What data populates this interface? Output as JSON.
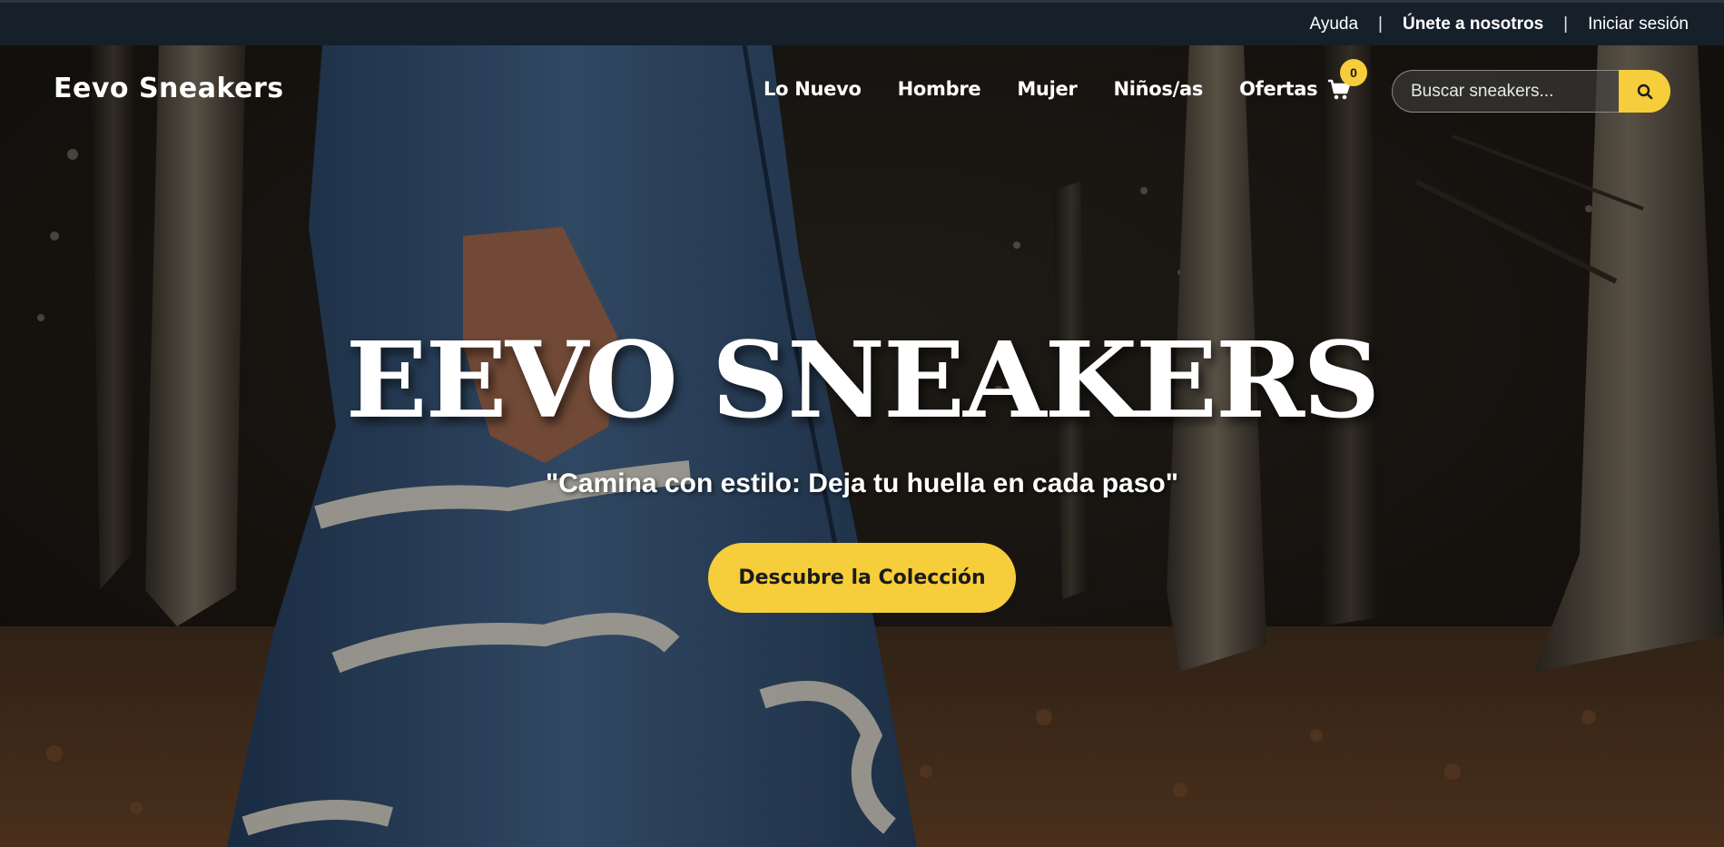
{
  "topbar": {
    "help": "Ayuda",
    "separator": "|",
    "join": "Únete a nosotros",
    "login": "Iniciar sesión"
  },
  "nav": {
    "logo": "Eevo Sneakers",
    "items": [
      "Lo Nuevo",
      "Hombre",
      "Mujer",
      "Niños/as",
      "Ofertas"
    ],
    "cart_count": "0",
    "search_placeholder": "Buscar sneakers..."
  },
  "hero": {
    "headline": "EEVO SNEAKERS",
    "tagline": "\"Camina con estilo: Deja tu huella en cada paso\"",
    "cta": "Descubre la Colección"
  },
  "colors": {
    "topbar_bg": "#15202b",
    "accent": "#f6cd3a",
    "text": "#ffffff"
  },
  "icons": [
    "shopping-cart-icon",
    "search-icon"
  ]
}
